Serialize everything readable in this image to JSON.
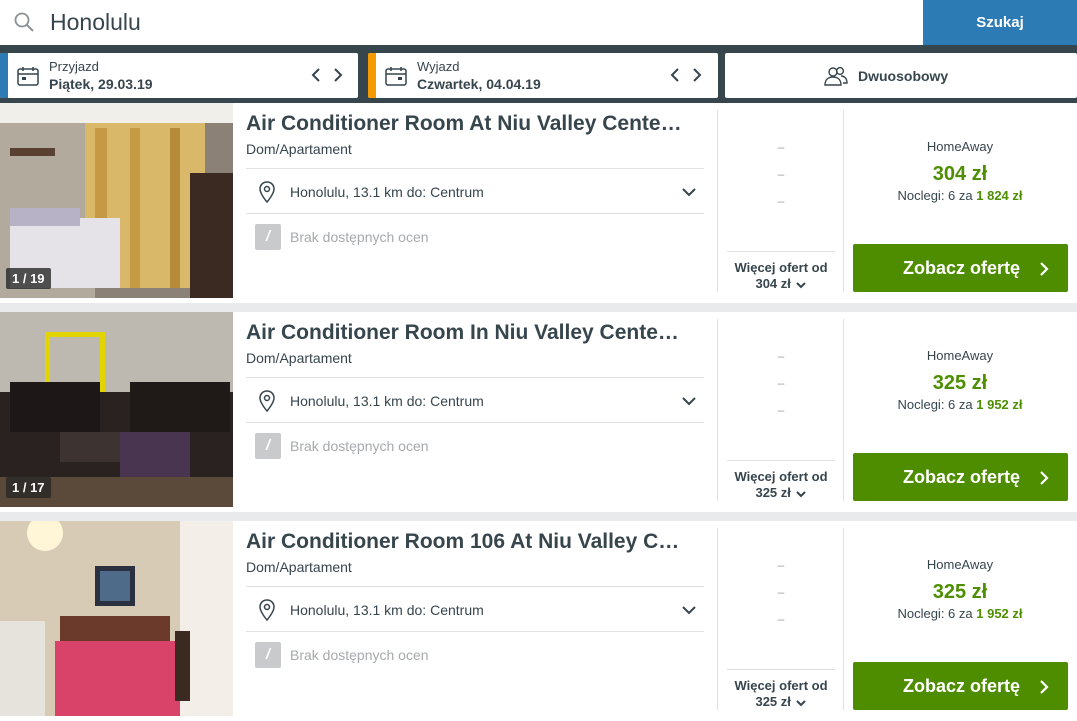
{
  "search": {
    "value": "Honolulu",
    "button_label": "Szukaj"
  },
  "dates": {
    "checkin": {
      "label": "Przyjazd",
      "value": "Piątek, 29.03.19",
      "accent": "#2d7bb5"
    },
    "checkout": {
      "label": "Wyjazd",
      "value": "Czwartek, 04.04.19",
      "accent": "#f59b00"
    }
  },
  "guests": {
    "label": "Dwuosobowy"
  },
  "colors": {
    "price_green": "#4d8f00",
    "button_green": "#4f8d00",
    "header_dark": "#37454d",
    "search_blue": "#2d7bb5"
  },
  "results": [
    {
      "title": "Air Conditioner Room At Niu Valley Cente…",
      "type": "Dom/Apartament",
      "location": "Honolulu, 13.1 km do: Centrum",
      "rating_badge": "/",
      "rating_text": "Brak dostępnych ocen",
      "image_counter": "1 / 19",
      "dashes": [
        "–",
        "–",
        "–"
      ],
      "more_offers_line1": "Więcej ofert od",
      "more_offers_line2": "304 zł",
      "provider": "HomeAway",
      "price": "304 zł",
      "nights_text": "Noclegi: 6 za",
      "total": "1 824 zł",
      "deal_button": "Zobacz ofertę"
    },
    {
      "title": "Air Conditioner Room In Niu Valley Cente…",
      "type": "Dom/Apartament",
      "location": "Honolulu, 13.1 km do: Centrum",
      "rating_badge": "/",
      "rating_text": "Brak dostępnych ocen",
      "image_counter": "1 / 17",
      "dashes": [
        "–",
        "–",
        "–"
      ],
      "more_offers_line1": "Więcej ofert od",
      "more_offers_line2": "325 zł",
      "provider": "HomeAway",
      "price": "325 zł",
      "nights_text": "Noclegi: 6 za",
      "total": "1 952 zł",
      "deal_button": "Zobacz ofertę"
    },
    {
      "title": "Air Conditioner Room 106 At Niu Valley C…",
      "type": "Dom/Apartament",
      "location": "Honolulu, 13.1 km do: Centrum",
      "rating_badge": "/",
      "rating_text": "Brak dostępnych ocen",
      "image_counter": "",
      "dashes": [
        "–",
        "–",
        "–"
      ],
      "more_offers_line1": "Więcej ofert od",
      "more_offers_line2": "325 zł",
      "provider": "HomeAway",
      "price": "325 zł",
      "nights_text": "Noclegi: 6 za",
      "total": "1 952 zł",
      "deal_button": "Zobacz ofertę"
    }
  ]
}
